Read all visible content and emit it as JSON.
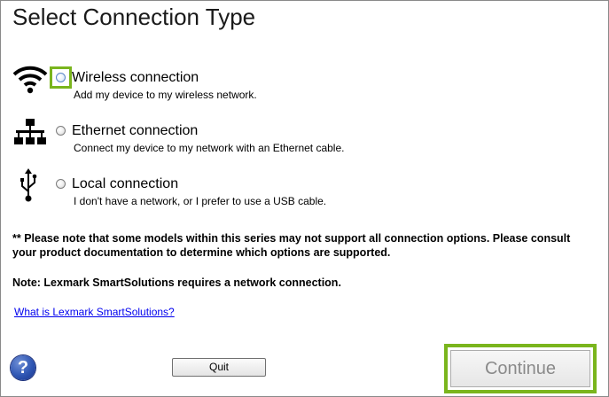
{
  "title": "Select Connection Type",
  "options": [
    {
      "icon": "wifi-icon",
      "label": "Wireless connection",
      "description": "Add my device to my wireless network.",
      "selected": false,
      "focused": true
    },
    {
      "icon": "ethernet-network-icon",
      "label": "Ethernet connection",
      "description": "Connect my device to my network with an Ethernet cable.",
      "selected": false,
      "focused": false
    },
    {
      "icon": "usb-icon",
      "label": "Local connection",
      "description": "I don't have a network, or I prefer to use a USB cable.",
      "selected": false,
      "focused": false
    }
  ],
  "notes": {
    "models_note": "** Please note that some models within this series may not support all connection options. Please consult your product documentation to determine which options are supported.",
    "network_note": "Note: Lexmark SmartSolutions requires a network connection."
  },
  "link": {
    "label": "What is Lexmark SmartSolutions?"
  },
  "help": {
    "symbol": "?"
  },
  "buttons": {
    "quit": "Quit",
    "continue": "Continue"
  },
  "colors": {
    "highlight": "#7ab51d",
    "link": "#0000ee",
    "help_blue": "#2f56b3"
  }
}
